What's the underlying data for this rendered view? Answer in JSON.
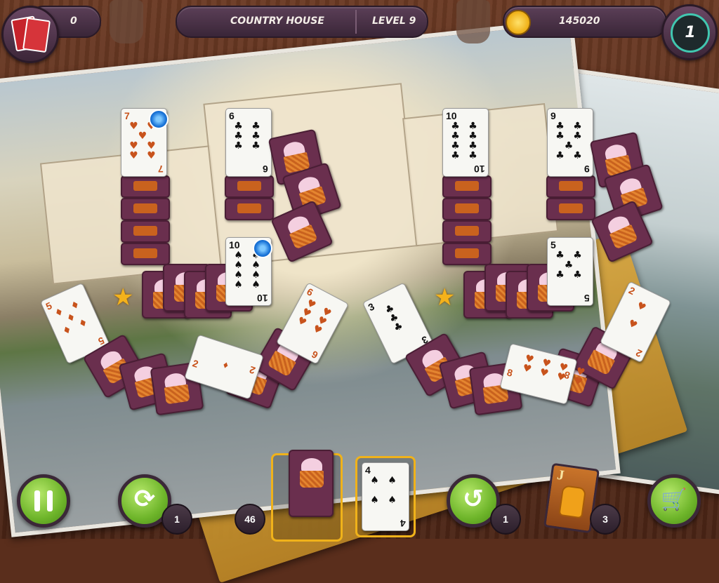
{
  "top_bar": {
    "score": "0",
    "location": "COUNTRY HOUSE",
    "level": "LEVEL 9",
    "coins": "145020",
    "level_badge": "1"
  },
  "cards": {
    "c7h": {
      "rank": "7",
      "suit": "♥",
      "pips": "♥ ♥\n♥\n♥ ♥\n♥ ♥"
    },
    "c6c": {
      "rank": "6",
      "suit": "♣",
      "pips": "♣ ♣\n♣ ♣\n♣ ♣"
    },
    "c10s": {
      "rank": "10",
      "suit": "♠",
      "pips": "♠ ♠\n♠ ♠\n♠ ♠\n♠ ♠"
    },
    "c10c": {
      "rank": "10",
      "suit": "♣",
      "pips": "♣ ♣\n♣ ♣\n♣ ♣\n♣ ♣"
    },
    "c9c": {
      "rank": "9",
      "suit": "♣",
      "pips": "♣ ♣\n♣ ♣\n♣\n♣ ♣"
    },
    "c5c": {
      "rank": "5",
      "suit": "♣",
      "pips": "♣ ♣\n♣\n♣ ♣"
    },
    "c5d": {
      "rank": "5",
      "suit": "♦",
      "pips": "♦ ♦\n♦\n♦ ♦"
    },
    "c2d": {
      "rank": "2",
      "suit": "♦",
      "pips": "♦\n\n♦"
    },
    "c6h": {
      "rank": "6",
      "suit": "♥",
      "pips": "♥ ♥\n♥ ♥\n♥ ♥"
    },
    "c3c": {
      "rank": "3",
      "suit": "♣",
      "pips": "♣\n♣\n♣"
    },
    "c8h": {
      "rank": "8",
      "suit": "♥",
      "pips": "♥ ♥ ♥ ♥\n♥ ♥ ♥ ♥"
    },
    "c2h": {
      "rank": "2",
      "suit": "♥",
      "pips": "♥\n\n♥"
    },
    "c4s": {
      "rank": "4",
      "suit": "♠",
      "pips": "♠ ♠\n\n♠ ♠"
    },
    "cJ": {
      "rank": "J"
    }
  },
  "bottom": {
    "shuffle_count": "1",
    "deck_count": "46",
    "undo_count": "1",
    "joker_count": "3"
  },
  "colors": {
    "accent_green": "#6eb52a",
    "panel_purple": "#3a2638",
    "card_red": "#c8531c"
  }
}
